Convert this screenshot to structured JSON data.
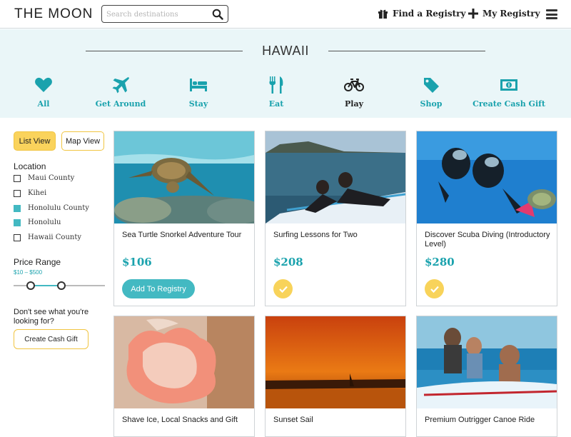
{
  "header": {
    "logo": "THE MOON",
    "search_placeholder": "Search destinations",
    "find_registry": "Find a Registry",
    "my_registry": "My Registry",
    "icons": [
      "search-icon",
      "gift-icon",
      "plus-icon",
      "menu-icon"
    ]
  },
  "destination": {
    "title": "HAWAII",
    "categories": [
      {
        "label": "All",
        "icon": "heart-icon"
      },
      {
        "label": "Get Around",
        "icon": "airplane-icon"
      },
      {
        "label": "Stay",
        "icon": "bed-icon"
      },
      {
        "label": "Eat",
        "icon": "utensils-icon"
      },
      {
        "label": "Play",
        "icon": "bicycle-icon"
      },
      {
        "label": "Shop",
        "icon": "tag-icon"
      },
      {
        "label": "Create Cash Gift",
        "icon": "cash-icon"
      }
    ]
  },
  "sidebar": {
    "list_view": "List View",
    "map_view": "Map View",
    "location_heading": "Location",
    "locations": [
      {
        "label": "Maui County",
        "checked": false
      },
      {
        "label": "Kihei",
        "checked": false
      },
      {
        "label": "Honolulu County",
        "checked": true
      },
      {
        "label": "Honolulu",
        "checked": true
      },
      {
        "label": "Hawaii County",
        "checked": false
      }
    ],
    "price_heading": "Price Range",
    "price_range": "$10 – $500",
    "price_min_fraction": 0.19,
    "price_max_fraction": 0.52,
    "dont_see": "Don't see what you're looking for?",
    "create_cash_gift": "Create Cash Gift"
  },
  "cards": [
    {
      "title": "Sea Turtle Snorkel Adventure Tour",
      "price": "$106",
      "action": "Add To Registry",
      "added": false
    },
    {
      "title": "Surfing Lessons for Two",
      "price": "$208",
      "added": true
    },
    {
      "title": "Discover Scuba Diving (Introductory Level)",
      "price": "$280",
      "added": true
    },
    {
      "title": "Shave Ice, Local Snacks and Gift"
    },
    {
      "title": "Sunset Sail"
    },
    {
      "title": "Premium Outrigger Canoe Ride"
    }
  ],
  "colors": {
    "accent": "#1aa2ad",
    "accent_light": "#43b9c2",
    "yellow": "#fad35c",
    "band": "#eaf6f8"
  }
}
